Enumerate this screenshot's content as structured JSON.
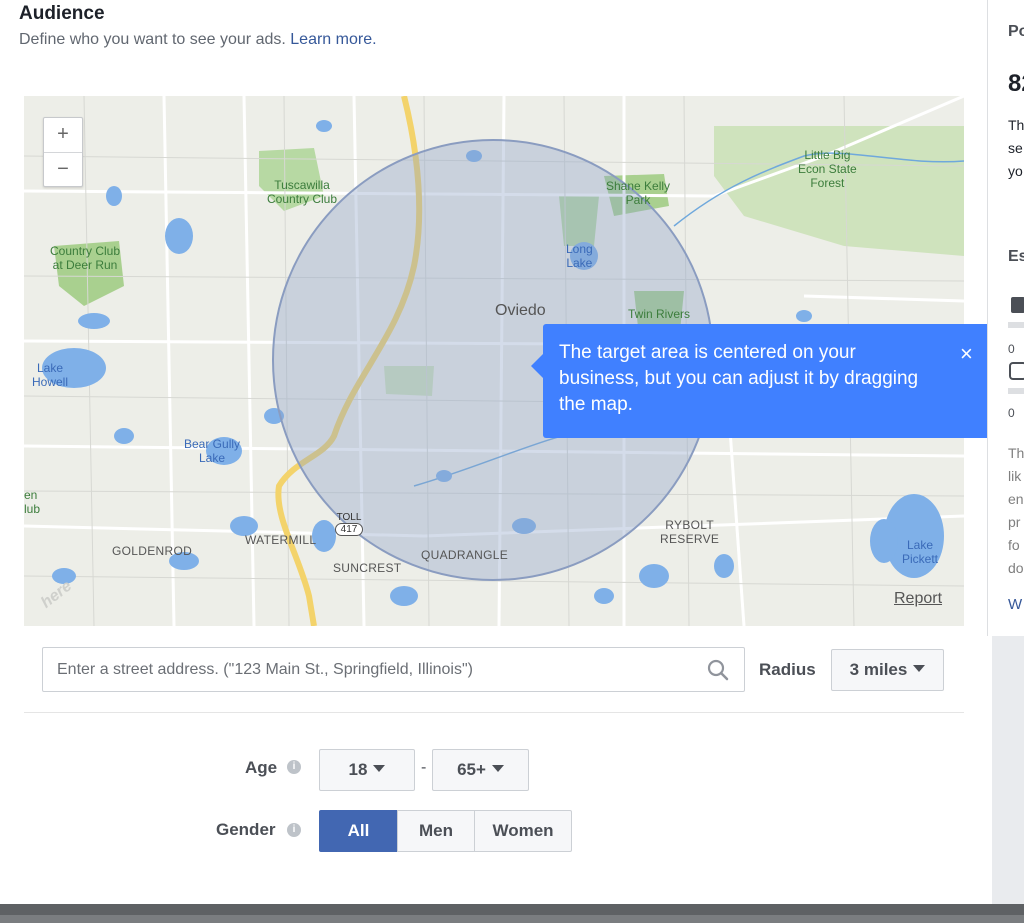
{
  "audience": {
    "title": "Audience",
    "subtitle": "Define who you want to see your ads.",
    "learn_more": "Learn more."
  },
  "map": {
    "zoom_in": "+",
    "zoom_out": "−",
    "labels": {
      "tuscawilla": "Tuscawilla\nCountry Club",
      "country_club_deer_run": "Country Club\nat Deer Run",
      "little_big_econ": "Little Big\nEcon State\nForest",
      "shane_kelly": "Shane Kelly\nPark",
      "long_lake": "Long\nLake",
      "oviedo": "Oviedo",
      "twin_rivers": "Twin Rivers",
      "lake_howell": "Lake\nHowell",
      "bear_gully": "Bear Gully\nLake",
      "toll": "TOLL",
      "route": "417",
      "goldenrod": "GOLDENROD",
      "watermill": "WATERMILL",
      "suncrest": "SUNCREST",
      "quadrangle": "QUADRANGLE",
      "rybolt": "RYBOLT\nRESERVE",
      "lake_pickett": "Lake\nPickett",
      "edge_club": "en\nlub"
    },
    "attribution": "here",
    "report": "Report"
  },
  "tooltip": {
    "text": "The target area is centered on your business, but you can adjust it by dragging the map.",
    "close": "×"
  },
  "address": {
    "placeholder": "Enter a street address. (\"123 Main St., Springfield, Illinois\")"
  },
  "radius": {
    "label": "Radius",
    "value": "3 miles"
  },
  "age": {
    "label": "Age",
    "min": "18",
    "separator": "-",
    "max": "65+"
  },
  "gender": {
    "label": "Gender",
    "options": [
      "All",
      "Men",
      "Women"
    ],
    "selected": "All"
  },
  "right_panel": {
    "heading": "Po",
    "number": "82",
    "text_lines": [
      "Th",
      "se",
      "yo"
    ],
    "est_heading": "Es",
    "count_1": "0",
    "count_2": "0",
    "para_lines": [
      "Th",
      "lik",
      "en",
      "pr",
      "fo",
      "do"
    ],
    "link": "W"
  },
  "colors": {
    "accent": "#4267b2",
    "tooltip": "#4080ff",
    "link": "#365899",
    "radius_fill": "#8fa3c9"
  }
}
